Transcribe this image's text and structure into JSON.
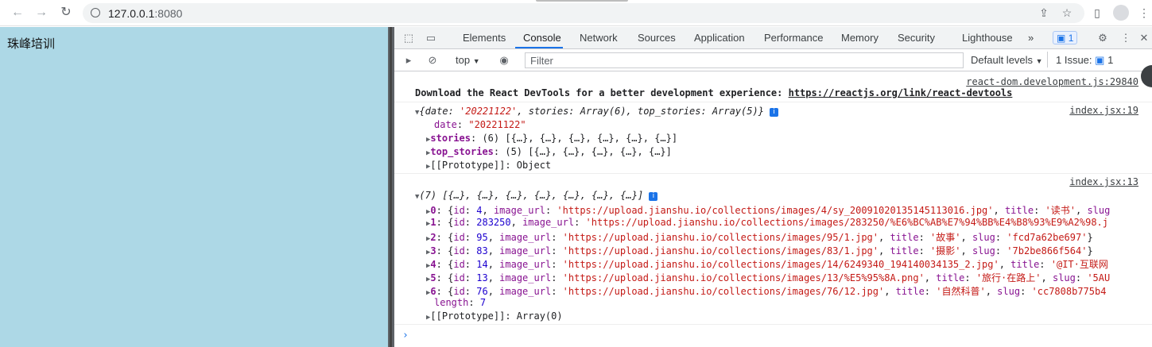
{
  "browser": {
    "url_host": "127.0.0.1",
    "url_port": ":8080"
  },
  "page": {
    "text": "珠峰培训"
  },
  "devtools": {
    "tabs": [
      "Elements",
      "Console",
      "Network",
      "Sources",
      "Application",
      "Performance",
      "Memory",
      "Security",
      "Lighthouse"
    ],
    "more_tabs": "»",
    "messages_badge": "1",
    "toolbar": {
      "context": "top",
      "filter_placeholder": "Filter",
      "levels": "Default levels",
      "issues_label": "1 Issue:",
      "issues_count": "1"
    }
  },
  "console": {
    "msg1": {
      "source": "react-dom.development.js:29840",
      "text": "Download the React DevTools for a better development experience: ",
      "link": "https://reactjs.org/link/react-devtools"
    },
    "msg2": {
      "source": "index.jsx:19",
      "summary_date_key": "date",
      "summary_date_val": "'20221122'",
      "summary_stories": "stories: Array(6)",
      "summary_top": "top_stories: Array(5)",
      "date_key": "date",
      "date_val": "\"20221122\"",
      "stories_key": "stories",
      "stories_val": "(6) [{…}, {…}, {…}, {…}, {…}, {…}]",
      "top_key": "top_stories",
      "top_val": "(5) [{…}, {…}, {…}, {…}, {…}]",
      "proto": "[[Prototype]]: Object"
    },
    "msg3": {
      "source": "index.jsx:13",
      "summary": "(7) [{…}, {…}, {…}, {…}, {…}, {…}, {…}]",
      "rows": [
        {
          "idx": "0",
          "id": "4",
          "url": "'https://upload.jianshu.io/collections/images/4/sy_20091020135145113016.jpg'",
          "title": "'读书'",
          "tail": ", slug"
        },
        {
          "idx": "1",
          "id": "283250",
          "url": "'https://upload.jianshu.io/collections/images/283250/%E6%BC%AB%E7%94%BB%E4%B8%93%E9%A2%98.j",
          "title": "",
          "tail": ""
        },
        {
          "idx": "2",
          "id": "95",
          "url": "'https://upload.jianshu.io/collections/images/95/1.jpg'",
          "title": "'故事'",
          "tail": ", slug: 'fcd7a62be697'}"
        },
        {
          "idx": "3",
          "id": "83",
          "url": "'https://upload.jianshu.io/collections/images/83/1.jpg'",
          "title": "'摄影'",
          "tail": ", slug: '7b2be866f564'}"
        },
        {
          "idx": "4",
          "id": "14",
          "url": "'https://upload.jianshu.io/collections/images/14/6249340_194140034135_2.jpg'",
          "title": "'@IT·互联网",
          "tail": ""
        },
        {
          "idx": "5",
          "id": "13",
          "url": "'https://upload.jianshu.io/collections/images/13/%E5%95%8A.png'",
          "title": "'旅行·在路上'",
          "tail": ", slug: '5AU"
        },
        {
          "idx": "6",
          "id": "76",
          "url": "'https://upload.jianshu.io/collections/images/76/12.jpg'",
          "title": "'自然科普'",
          "tail": ", slug: 'cc7808b775b4"
        }
      ],
      "length_key": "length",
      "length_val": "7",
      "proto": "[[Prototype]]: Array(0)"
    },
    "prompt": "›"
  }
}
